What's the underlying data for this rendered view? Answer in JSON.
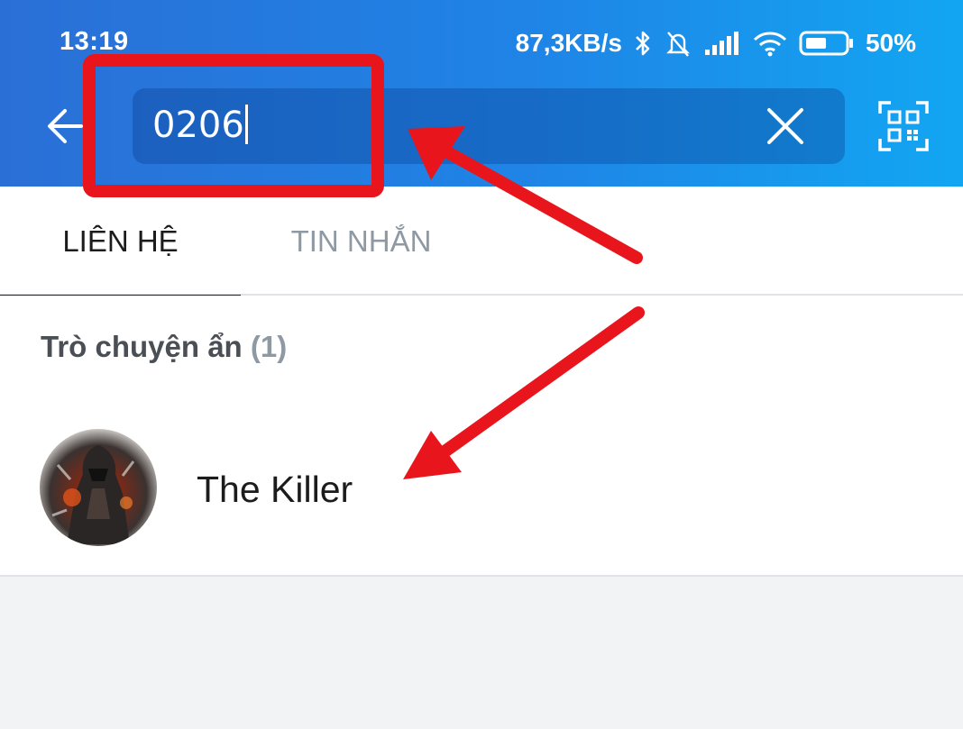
{
  "status_bar": {
    "time": "13:19",
    "network_speed": "87,3KB/s",
    "battery": "50%",
    "icons": [
      "bluetooth-icon",
      "bell-muted-icon",
      "signal-icon",
      "wifi-icon",
      "battery-icon"
    ]
  },
  "header": {
    "back_icon": "arrow-left-icon",
    "search_value": "0206",
    "clear_icon": "close-icon",
    "qr_icon": "qr-code-icon"
  },
  "tabs": [
    {
      "label": "LIÊN HỆ",
      "active": true
    },
    {
      "label": "TIN NHẮN",
      "active": false
    }
  ],
  "results": {
    "section_title": "Trò chuyện ẩn",
    "section_count": "(1)",
    "items": [
      {
        "name": "The Killer",
        "avatar": "avatar-image"
      }
    ]
  },
  "colors": {
    "header_gradient_start": "#2a6fd6",
    "header_gradient_end": "#12a6f2",
    "annotation_red": "#e8161c",
    "tab_inactive": "#8e99a4"
  }
}
